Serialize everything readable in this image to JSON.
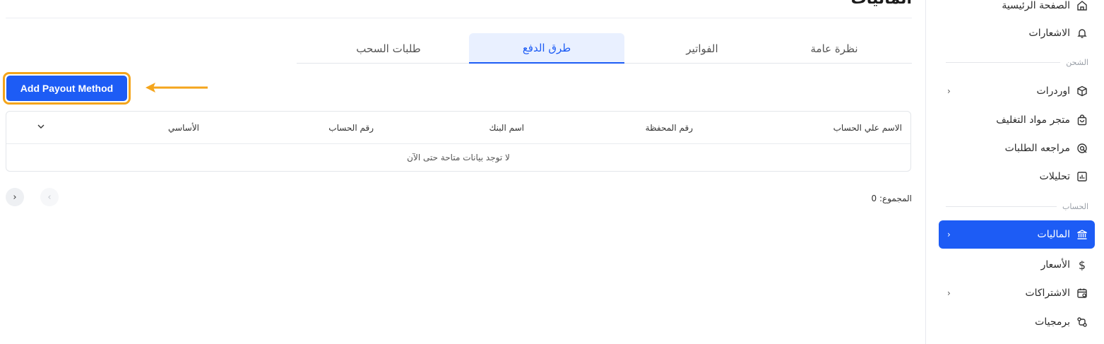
{
  "page": {
    "title": "الماليات"
  },
  "tabs": [
    {
      "label": "نظرة عامة"
    },
    {
      "label": "الفواتير"
    },
    {
      "label": "طرق الدفع"
    },
    {
      "label": "طلبات السحب"
    }
  ],
  "active_tab": "طرق الدفع",
  "toolbar": {
    "add_label": "Add Payout Method"
  },
  "table": {
    "columns": [
      "الاسم علي الحساب",
      "رقم المحفظة",
      "اسم البنك",
      "رقم الحساب",
      "الأساسي"
    ],
    "empty_text": "لا توجد بيانات متاحة حتى الآن"
  },
  "footer": {
    "total_label": "المجموع: 0"
  },
  "sidebar": {
    "items": [
      {
        "label": "الصفحة الرئيسية",
        "icon": "home-icon"
      },
      {
        "label": "الاشعارات",
        "icon": "bell-icon"
      },
      {
        "label": "اوردرات",
        "icon": "box-icon"
      },
      {
        "label": "متجر مواد التغليف",
        "icon": "shopping-bag-icon"
      },
      {
        "label": "مراجعه الطلبات",
        "icon": "review-icon"
      },
      {
        "label": "تحليلات",
        "icon": "chart-icon"
      },
      {
        "label": "الماليات",
        "icon": "bank-icon"
      },
      {
        "label": "الأسعار",
        "icon": "dollar-icon"
      },
      {
        "label": "الاشتراكات",
        "icon": "calendar-icon"
      },
      {
        "label": "برمجيات",
        "icon": "api-icon"
      }
    ],
    "sections": {
      "shipping": "الشحن",
      "account": "الحساب"
    }
  },
  "colors": {
    "accent": "#1d5cf5",
    "highlight": "#f4a51c"
  }
}
